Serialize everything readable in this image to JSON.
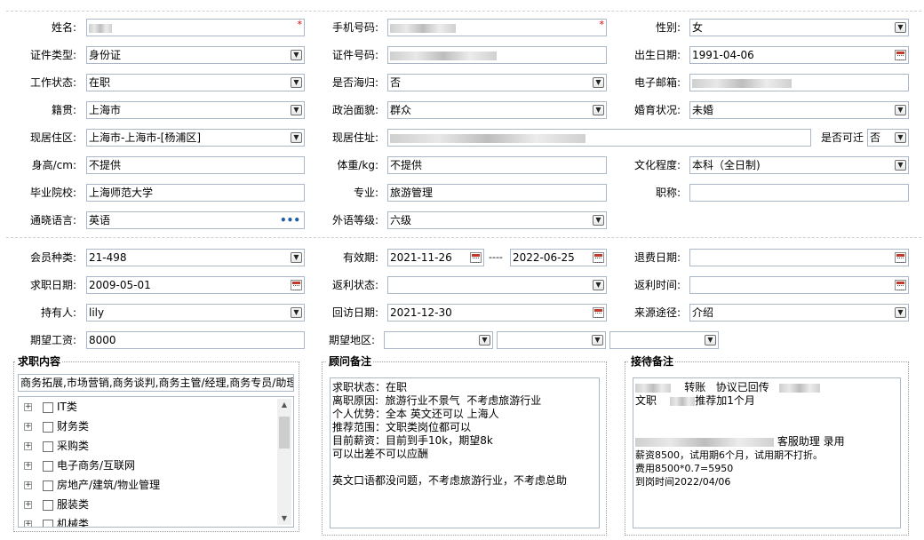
{
  "basic": {
    "name_label": "姓名:",
    "phone_label": "手机号码:",
    "gender_label": "性别:",
    "gender_value": "女",
    "idtype_label": "证件类型:",
    "idtype_value": "身份证",
    "idno_label": "证件号码:",
    "birth_label": "出生日期:",
    "birth_value": "1991-04-06",
    "workstatus_label": "工作状态:",
    "workstatus_value": "在职",
    "returnee_label": "是否海归:",
    "returnee_value": "否",
    "email_label": "电子邮箱:",
    "hometown_label": "籍贯:",
    "hometown_value": "上海市",
    "political_label": "政治面貌:",
    "political_value": "群众",
    "marital_label": "婚育状况:",
    "marital_value": "未婚",
    "residence_label": "现居住区:",
    "residence_value": "上海市-上海市-[杨浦区]",
    "address_label": "现居住址:",
    "relocate_label": "是否可迁",
    "relocate_value": "否",
    "height_label": "身高/cm:",
    "height_value": "不提供",
    "weight_label": "体重/kg:",
    "weight_value": "不提供",
    "education_label": "文化程度:",
    "education_value": "本科（全日制)",
    "school_label": "毕业院校:",
    "school_value": "上海师范大学",
    "major_label": "专业:",
    "major_value": "旅游管理",
    "title_label": "职称:",
    "title_value": "",
    "language_label": "通晓语言:",
    "language_value": "英语",
    "lang_level_label": "外语等级:",
    "lang_level_value": "六级"
  },
  "member": {
    "type_label": "会员种类:",
    "type_value": "21-498",
    "validity_label": "有效期:",
    "validity_from": "2021-11-26",
    "validity_sep": "----",
    "validity_to": "2022-06-25",
    "refund_date_label": "退费日期:",
    "refund_date_value": "",
    "job_date_label": "求职日期:",
    "job_date_value": "2009-05-01",
    "rebate_status_label": "返利状态:",
    "rebate_status_value": "",
    "rebate_time_label": "返利时间:",
    "rebate_time_value": "",
    "holder_label": "持有人:",
    "holder_value": "lily",
    "visit_date_label": "回访日期:",
    "visit_date_value": "2021-12-30",
    "source_label": "来源途径:",
    "source_value": "介绍",
    "salary_label": "期望工资:",
    "salary_value": "8000",
    "region_label": "期望地区:"
  },
  "job_content": {
    "title": "求职内容",
    "selected": "商务拓展,市场营销,商务谈判,商务主管/经理,商务专员/助理",
    "categories": [
      "IT类",
      "财务类",
      "采购类",
      "电子商务/互联网",
      "房地产/建筑/物业管理",
      "服装类",
      "机械类"
    ]
  },
  "consultant_notes": {
    "title": "顾问备注",
    "text": "求职状态：在职\n离职原因:  旅游行业不景气  不考虑旅游行业\n个人优势：全本 英文还可以 上海人\n推荐范围：文职类岗位都可以\n目前薪资：目前到手10k，期望8k\n可以出差不可以应酬\n\n英文口语都没问题，不考虑旅游行业，不考虑总助"
  },
  "reception_notes": {
    "title": "接待备注",
    "line1_a": "转账",
    "line1_b": "协议已回传",
    "line2_a": "文职",
    "line2_b": "推荐加1个月",
    "line3": "客服助理 录用",
    "line4": "薪资8500，试用期6个月，试用期不打折。",
    "line5": "费用8500*0.7=5950",
    "line6": "到岗时间2022/04/06"
  },
  "colors": {
    "border": "#a9b7c6",
    "required": "#dd0000"
  }
}
